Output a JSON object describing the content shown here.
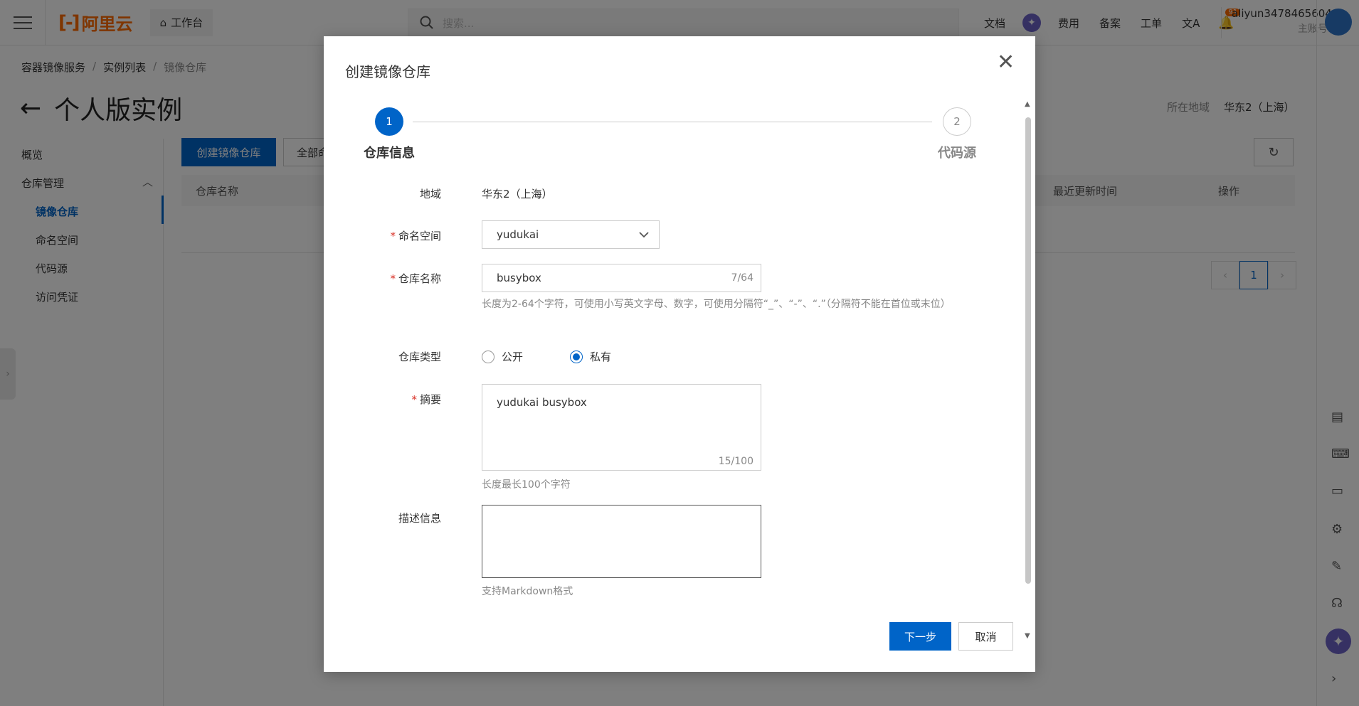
{
  "topbar": {
    "logo_text": "阿里云",
    "workbench": "工作台",
    "search_placeholder": "搜索...",
    "nav": [
      "文档",
      "费用",
      "备案",
      "工单"
    ],
    "notification_count": "91",
    "account_name": "aliyun3478465604",
    "account_type": "主账号"
  },
  "breadcrumb": [
    "容器镜像服务",
    "实例列表",
    "镜像仓库"
  ],
  "page": {
    "title": "个人版实例",
    "region_label": "所在地域",
    "region_value": "华东2（上海）"
  },
  "sidebar": {
    "items": [
      {
        "label": "概览"
      },
      {
        "label": "仓库管理"
      },
      {
        "label": "镜像仓库"
      },
      {
        "label": "命名空间"
      },
      {
        "label": "代码源"
      },
      {
        "label": "访问凭证"
      }
    ]
  },
  "toolbar": {
    "create_label": "创建镜像仓库",
    "all_label": "全部命"
  },
  "table": {
    "columns": [
      "仓库名称",
      "最近更新时间",
      "操作"
    ]
  },
  "pager": {
    "current": "1"
  },
  "modal": {
    "title": "创建镜像仓库",
    "steps": [
      {
        "num": "1",
        "label": "仓库信息"
      },
      {
        "num": "2",
        "label": "代码源"
      }
    ],
    "region": {
      "label": "地域",
      "value": "华东2（上海）"
    },
    "namespace": {
      "label": "命名空间",
      "value": "yudukai"
    },
    "repo_name": {
      "label": "仓库名称",
      "value": "busybox",
      "count": "7/64",
      "help": "长度为2-64个字符，可使用小写英文字母、数字，可使用分隔符“_”、“-”、“.”（分隔符不能在首位或末位）"
    },
    "repo_type": {
      "label": "仓库类型",
      "options": [
        "公开",
        "私有"
      ],
      "selected": "私有"
    },
    "summary": {
      "label": "摘要",
      "value": "yudukai busybox",
      "count": "15/100",
      "help": "长度最长100个字符"
    },
    "description": {
      "label": "描述信息",
      "value": "",
      "help": "支持Markdown格式"
    },
    "next_label": "下一步",
    "cancel_label": "取消"
  }
}
